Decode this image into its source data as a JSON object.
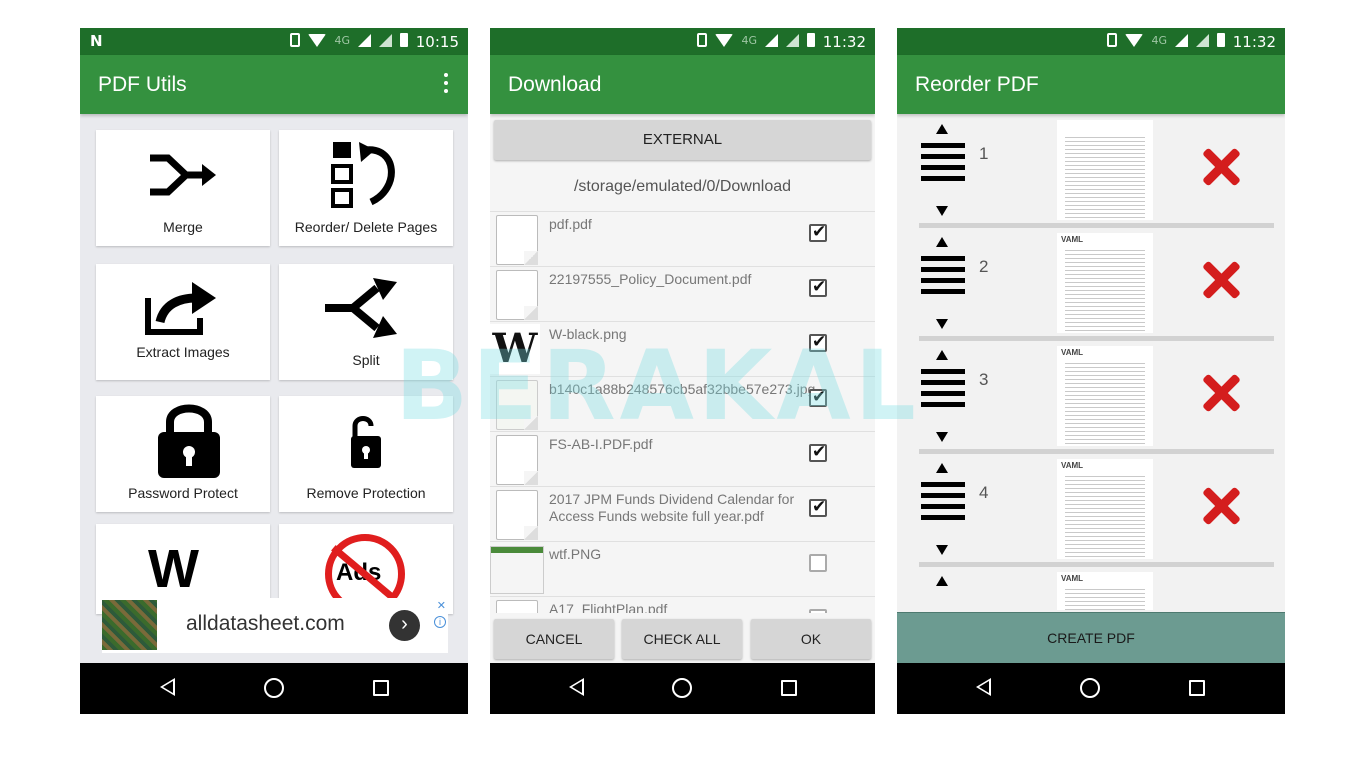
{
  "watermark": "BERAKAL",
  "phone1": {
    "status_time": "10:15",
    "status_lte": "4G",
    "title": "PDF Utils",
    "cards": [
      {
        "label": "Merge",
        "icon": "merge-icon"
      },
      {
        "label": "Reorder/ Delete Pages",
        "icon": "reorder-icon"
      },
      {
        "label": "Extract Images",
        "icon": "share-icon"
      },
      {
        "label": "Split",
        "icon": "split-icon"
      },
      {
        "label": "Password Protect",
        "icon": "lock-icon"
      },
      {
        "label": "Remove Protection",
        "icon": "unlock-icon"
      },
      {
        "label": "",
        "icon": "watermark-w-icon"
      },
      {
        "label": "",
        "icon": "no-ads-icon"
      }
    ],
    "card7_glyph": "W",
    "card8_glyph": "Ads",
    "ad_text": "alldatasheet.com",
    "ad_go": "›",
    "ad_close": "✕",
    "ad_info": "i"
  },
  "phone2": {
    "status_time": "11:32",
    "status_lte": "4G",
    "title": "Download",
    "external_button": "EXTERNAL",
    "path": "/storage/emulated/0/Download",
    "files": [
      {
        "name": "pdf.pdf",
        "checked": true
      },
      {
        "name": "22197555_Policy_Document.pdf",
        "checked": true
      },
      {
        "name": "W-black.png",
        "checked": true
      },
      {
        "name": "b140c1a88b248576cb5af32bbe57e273.jpg",
        "checked": true
      },
      {
        "name": "FS-AB-I.PDF.pdf",
        "checked": true
      },
      {
        "name": "2017 JPM Funds Dividend Calendar for Access Funds website full year.pdf",
        "checked": true
      },
      {
        "name": "wtf.PNG",
        "checked": false
      },
      {
        "name": "A17_FlightPlan.pdf",
        "checked": false
      }
    ],
    "w_thumb_glyph": "W",
    "buttons": {
      "cancel": "CANCEL",
      "check_all": "CHECK ALL",
      "ok": "OK"
    }
  },
  "phone3": {
    "status_time": "11:32",
    "status_lte": "4G",
    "title": "Reorder PDF",
    "pages": [
      {
        "number": "1",
        "header": ""
      },
      {
        "number": "2",
        "header": "VAML"
      },
      {
        "number": "3",
        "header": "VAML"
      },
      {
        "number": "4",
        "header": "VAML"
      },
      {
        "number": "",
        "header": "VAML"
      }
    ],
    "create_button": "CREATE PDF"
  }
}
